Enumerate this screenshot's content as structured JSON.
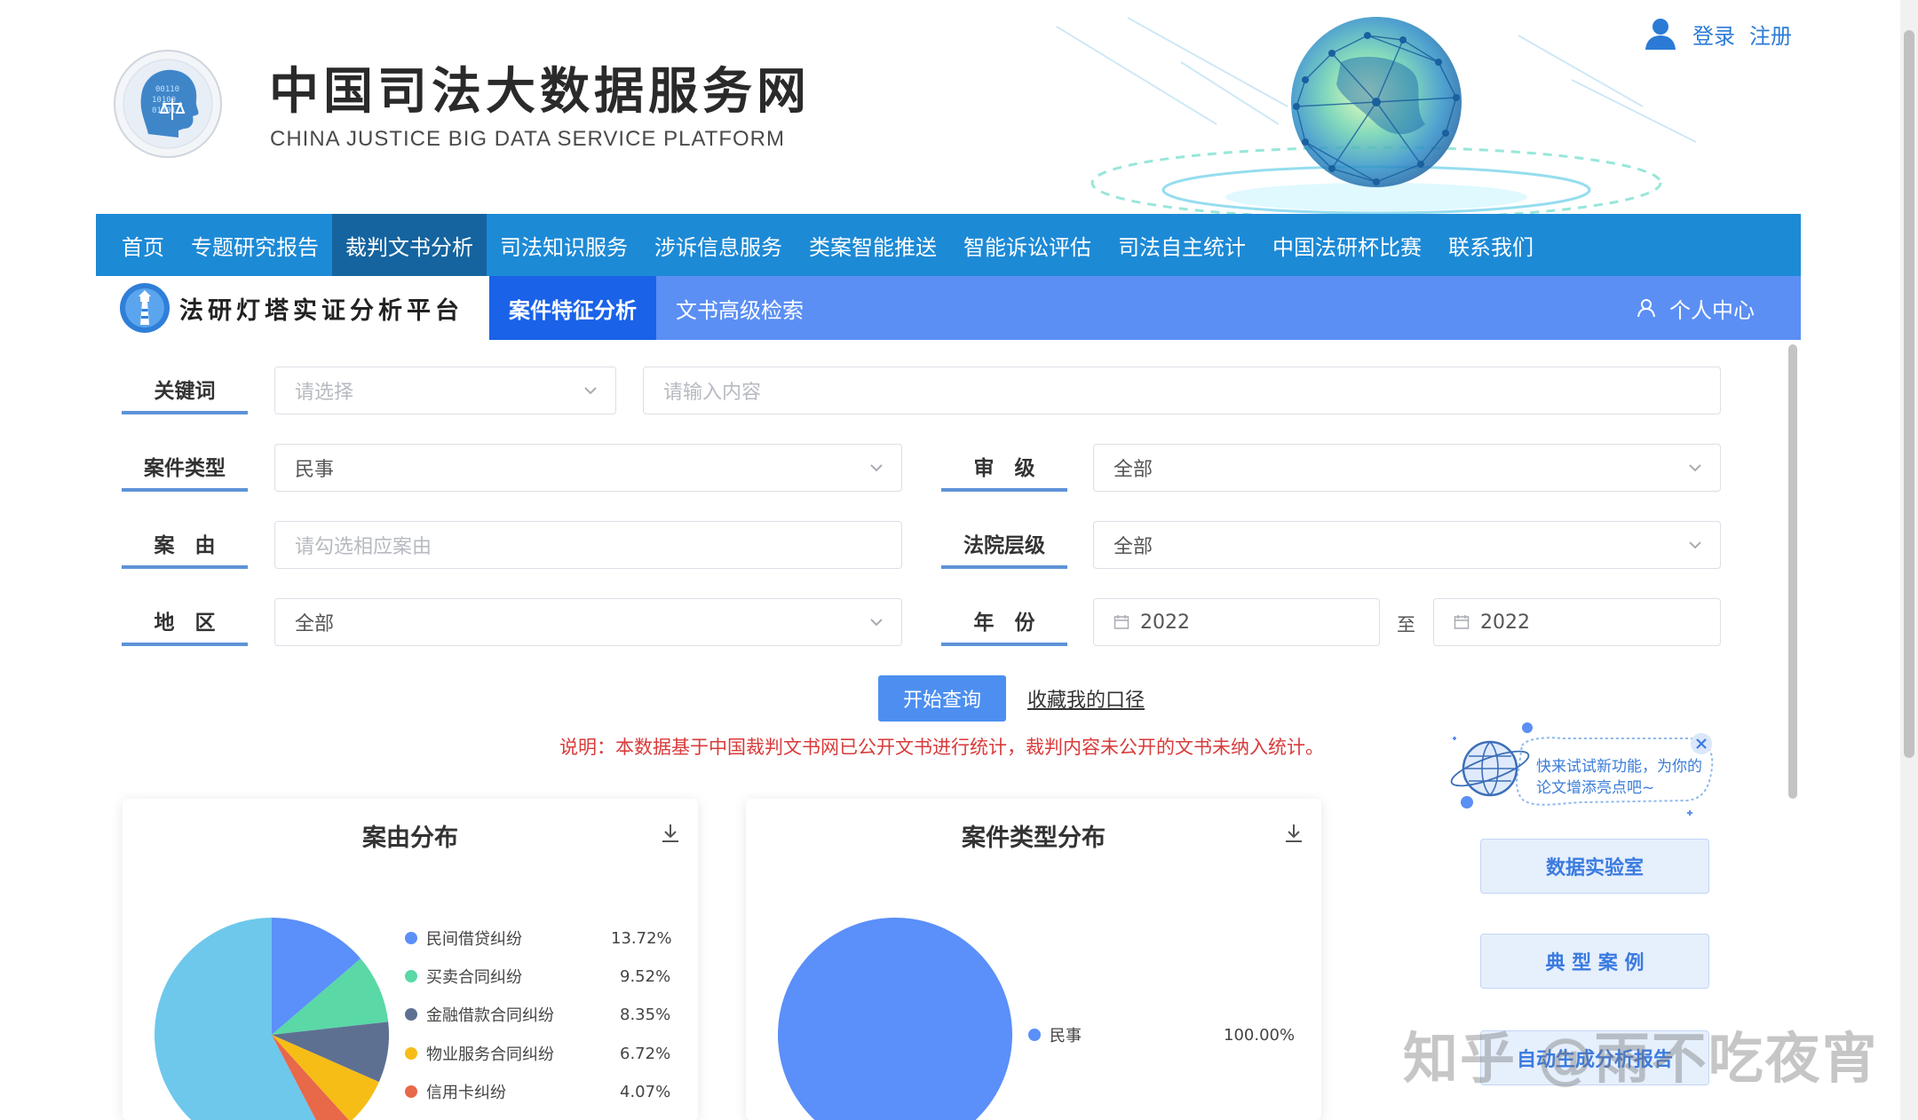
{
  "site": {
    "title": "中国司法大数据服务网",
    "subtitle": "CHINA JUSTICE BIG DATA SERVICE PLATFORM",
    "login": "登录",
    "register": "注册"
  },
  "main_nav": [
    "首页",
    "专题研究报告",
    "裁判文书分析",
    "司法知识服务",
    "涉诉信息服务",
    "类案智能推送",
    "智能诉讼评估",
    "司法自主统计",
    "中国法研杯比赛",
    "联系我们"
  ],
  "main_nav_active": 2,
  "sub_nav": {
    "platform_title": "法研灯塔实证分析平台",
    "tabs": [
      "案件特征分析",
      "文书高级检索"
    ],
    "personal_center": "个人中心"
  },
  "form": {
    "keyword": {
      "label": "关键词",
      "select_placeholder": "请选择",
      "input_placeholder": "请输入内容"
    },
    "case_type": {
      "label": "案件类型",
      "value": "民事"
    },
    "trial_level": {
      "label": "审　级",
      "value": "全部"
    },
    "cause": {
      "label": "案　由",
      "placeholder": "请勾选相应案由"
    },
    "court_level": {
      "label": "法院层级",
      "value": "全部"
    },
    "region": {
      "label": "地　区",
      "value": "全部"
    },
    "year": {
      "label": "年　份",
      "from": "2022",
      "to": "2022",
      "separator": "至"
    },
    "query_button": "开始查询",
    "favorite_link": "收藏我的口径",
    "notice": "说明：本数据基于中国裁判文书网已公开文书进行统计，裁判内容未公开的文书未纳入统计。"
  },
  "sidebar": {
    "promo": "快来试试新功能，为你的论文增添亮点吧~",
    "buttons": [
      "数据实验室",
      "典 型 案 例",
      "自动生成分析报告"
    ]
  },
  "watermark": "知乎 @雨不吃夜宵",
  "chart_data": [
    {
      "type": "pie",
      "title": "案由分布",
      "categories": [
        "民间借贷纠纷",
        "买卖合同纠纷",
        "金融借款合同纠纷",
        "物业服务合同纠纷",
        "信用卡纠纷"
      ],
      "labels": [
        "13.72%",
        "9.52%",
        "8.35%",
        "6.72%",
        "4.07%"
      ],
      "values": [
        13.72,
        9.52,
        8.35,
        6.72,
        4.07
      ],
      "colors": [
        "#5b8ff9",
        "#5ad8a6",
        "#5d7092",
        "#f6bd16",
        "#e8684a"
      ],
      "remainder_color": "#6dc8ec",
      "legend": "right"
    },
    {
      "type": "pie",
      "title": "案件类型分布",
      "categories": [
        "民事"
      ],
      "labels": [
        "100.00%"
      ],
      "values": [
        100.0
      ],
      "colors": [
        "#5b8ff9"
      ],
      "legend": "right"
    }
  ]
}
